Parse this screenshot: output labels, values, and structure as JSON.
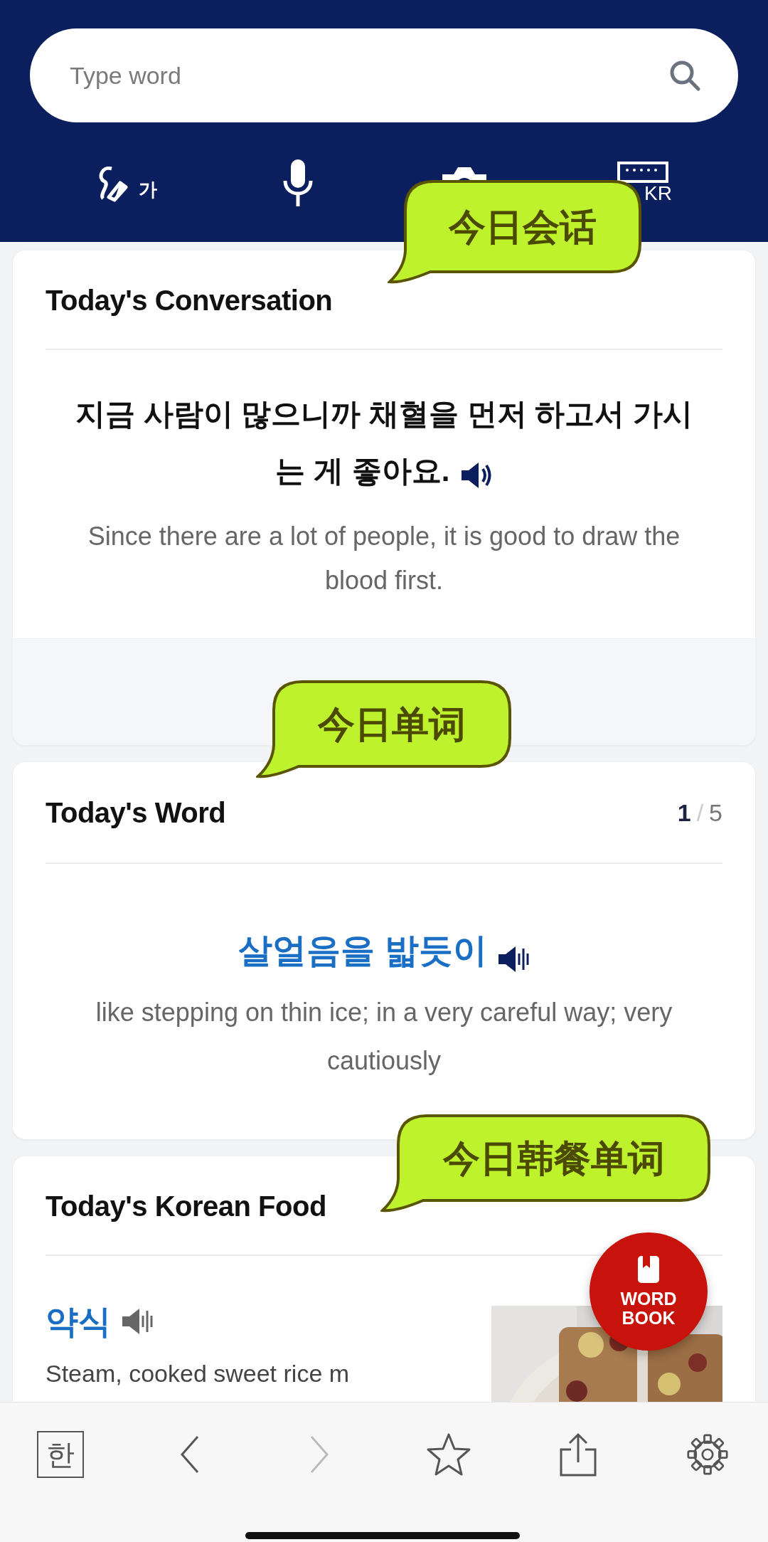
{
  "search": {
    "placeholder": "Type word"
  },
  "input_tools": [
    {
      "kind": "handwriting",
      "label": "가"
    },
    {
      "kind": "voice"
    },
    {
      "kind": "camera"
    },
    {
      "kind": "keyboard",
      "label": "KR"
    }
  ],
  "conversation": {
    "title": "Today's Conversation",
    "korean_lines": [
      "지금 사람이 많으니까 채혈을 먼저 하고서 가시",
      "는 게 좋아요."
    ],
    "english": "Since there are a lot of people, it is good to draw the blood first."
  },
  "word": {
    "title": "Today's Word",
    "current": "1",
    "separator": "/",
    "total": "5",
    "korean": "살얼음을 밟듯이",
    "meaning": "like stepping on thin ice; in a very careful way; very cautiously"
  },
  "food": {
    "title": "Today's Korean Food",
    "name": "약식",
    "description": "Steam, cooked sweet rice m"
  },
  "annotations": [
    {
      "text": "今日会话"
    },
    {
      "text": "今日单词"
    },
    {
      "text": "今日韩餐单词"
    }
  ],
  "word_book_button": {
    "lines": [
      "WORD",
      "BOOK"
    ]
  },
  "toolbar": [
    {
      "kind": "hangul",
      "label": "한"
    },
    {
      "kind": "back",
      "disabled": false
    },
    {
      "kind": "forward",
      "disabled": true
    },
    {
      "kind": "favorite"
    },
    {
      "kind": "share"
    },
    {
      "kind": "settings"
    }
  ]
}
